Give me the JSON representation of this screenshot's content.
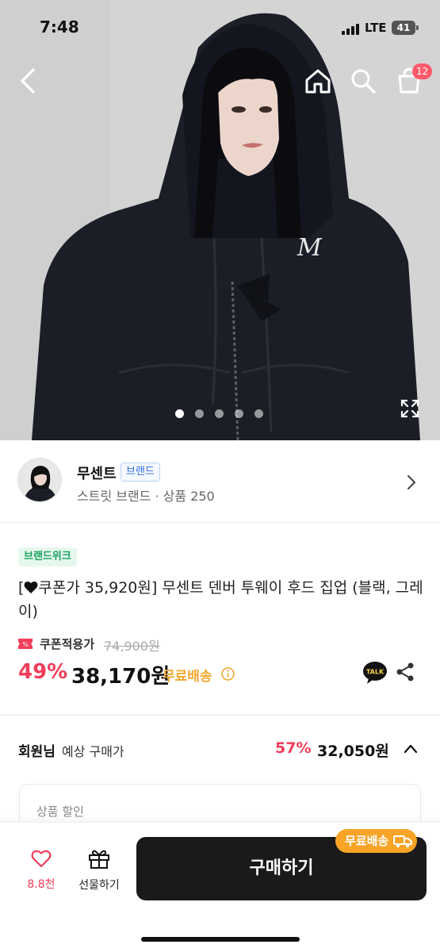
{
  "status_bar": {
    "time": "7:48",
    "network": "LTE",
    "battery": "41"
  },
  "header": {
    "cart_count": "12",
    "icons": [
      "back-icon",
      "home-icon",
      "search-icon",
      "cart-icon"
    ]
  },
  "hero": {
    "image_index": 1,
    "image_count": 5,
    "logo_text": "M"
  },
  "brand": {
    "name": "무센트",
    "badge": "브랜드",
    "subtitle": "스트릿 브랜드 · 상품 250"
  },
  "product": {
    "tag": "브랜드위크",
    "title": "쿠폰가 35,920원] 무센트 덴버 투웨이 후드 집업 (블랙, 그레이)",
    "title_prefix": "[",
    "coupon_label": "쿠폰적용가",
    "original_price": "74,900원",
    "discount": "49%",
    "price": "38,170원",
    "free_shipping": "무료배송"
  },
  "member_price": {
    "label_bold": "회원님",
    "label": "예상 구매가",
    "discount": "57%",
    "price": "32,050원"
  },
  "discount_box": {
    "title": "상품 할인"
  },
  "bottom_bar": {
    "like_count": "8.8천",
    "gift_label": "선물하기",
    "buy_label": "구매하기",
    "shipping_badge": "무료배송"
  },
  "colors": {
    "accent_red": "#f03e5a",
    "shipping_orange": "#f8a427",
    "brand_badge_blue": "#2d6fe0",
    "tag_green": "#1aa260",
    "buy_button": "#1a1a1a"
  }
}
